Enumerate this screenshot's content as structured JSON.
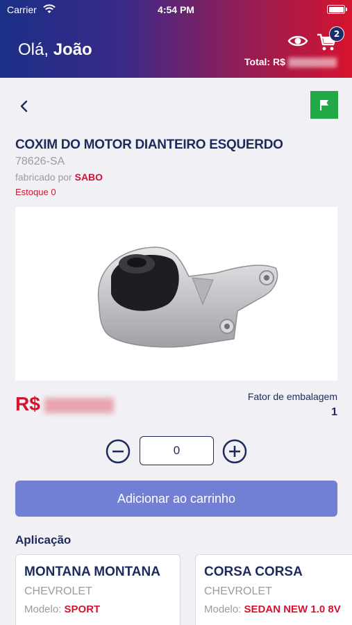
{
  "status_bar": {
    "carrier": "Carrier",
    "time": "4:54 PM"
  },
  "header": {
    "greeting_prefix": "Olá,",
    "user_name": "João",
    "cart_count": "2",
    "total_label": "Total: R$"
  },
  "product": {
    "name": "COXIM DO MOTOR DIANTEIRO ESQUERDO",
    "sku": "78626-SA",
    "maker_label": "fabricado por",
    "maker": "SABO",
    "stock": "Estoque 0",
    "price_currency": "R$",
    "pack_label": "Fator de embalagem",
    "pack_value": "1",
    "quantity": "0"
  },
  "actions": {
    "add_to_cart": "Adicionar ao carrinho"
  },
  "application": {
    "title": "Aplicação",
    "items": [
      {
        "name": "MONTANA MONTANA",
        "make": "CHEVROLET",
        "model_label": "Modelo:",
        "model": "SPORT"
      },
      {
        "name": "CORSA CORSA",
        "make": "CHEVROLET",
        "model_label": "Modelo:",
        "model": "SEDAN NEW 1.0 8V"
      }
    ]
  },
  "colors": {
    "brand_blue": "#1d2a5c",
    "brand_red": "#d5132f",
    "flag_green": "#22a845",
    "button_blue": "#717fd5"
  }
}
